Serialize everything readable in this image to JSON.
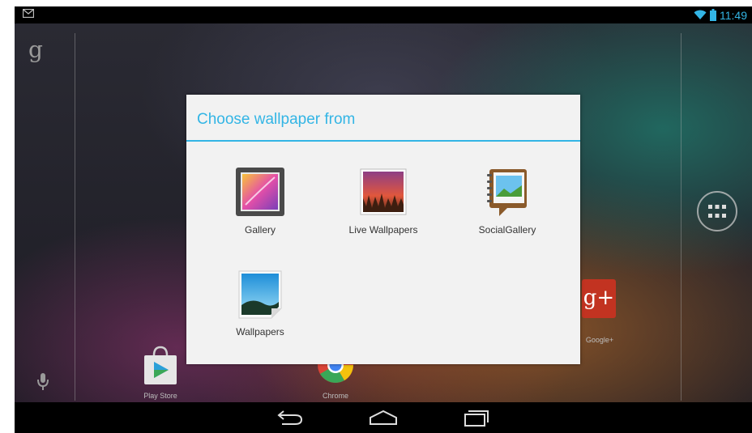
{
  "status_bar": {
    "time": "11:49",
    "icons": [
      "gmail-notification-icon",
      "wifi-icon",
      "battery-icon"
    ]
  },
  "home": {
    "google_search_glyph": "g",
    "icons": [
      "mic-icon",
      "all-apps-icon"
    ],
    "dock": [
      {
        "label": "Play Store",
        "icon": "play-store-icon"
      },
      {
        "label": "Chrome",
        "icon": "chrome-icon"
      },
      {
        "label": "Google+",
        "icon": "google-plus-icon"
      }
    ]
  },
  "dialog": {
    "title": "Choose wallpaper from",
    "options": [
      {
        "label": "Gallery",
        "icon": "gallery-icon"
      },
      {
        "label": "Live Wallpapers",
        "icon": "live-wallpapers-icon"
      },
      {
        "label": "SocialGallery",
        "icon": "social-gallery-icon"
      },
      {
        "label": "Wallpapers",
        "icon": "wallpapers-icon"
      }
    ]
  },
  "nav_bar": {
    "icons": [
      "back-icon",
      "home-icon",
      "recent-apps-icon"
    ]
  },
  "colors": {
    "accent": "#33b5e5",
    "dialog_background": "#f2f2f2",
    "google_plus_red": "#c23321"
  }
}
